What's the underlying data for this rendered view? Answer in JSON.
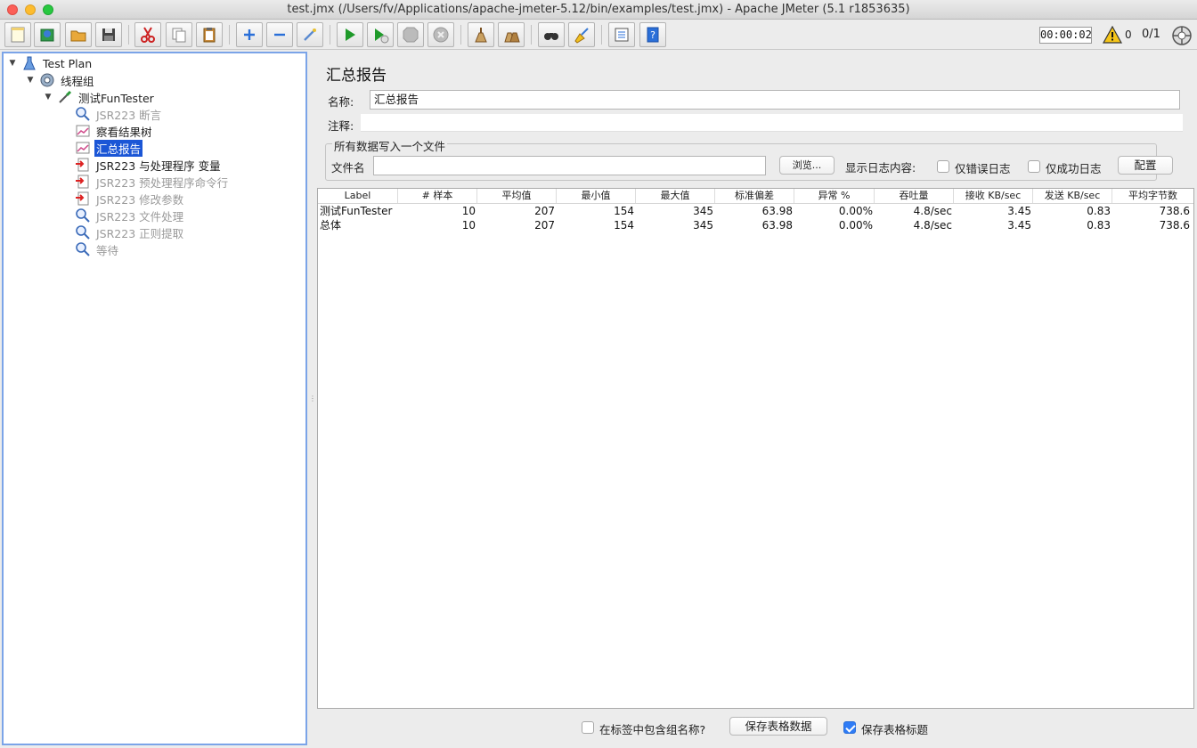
{
  "window": {
    "title": "test.jmx (/Users/fv/Applications/apache-jmeter-5.12/bin/examples/test.jmx) - Apache JMeter (5.1 r1853635)"
  },
  "toolbar": {
    "timer": "00:00:02",
    "warning_count": "0",
    "thread_count": "0/1"
  },
  "tree": {
    "nodes": [
      {
        "label": "Test Plan"
      },
      {
        "label": "线程组"
      },
      {
        "label": "测试FunTester"
      },
      {
        "label": "JSR223 断言"
      },
      {
        "label": "察看结果树"
      },
      {
        "label": "汇总报告"
      },
      {
        "label": "JSR223 与处理程序 变量"
      },
      {
        "label": "JSR223 预处理程序命令行"
      },
      {
        "label": "JSR223 修改参数"
      },
      {
        "label": "JSR223 文件处理"
      },
      {
        "label": "JSR223 正则提取"
      },
      {
        "label": "等待"
      }
    ]
  },
  "panel": {
    "title": "汇总报告",
    "name_label": "名称:",
    "name_value": "汇总报告",
    "comment_label": "注释:",
    "comment_value": "",
    "file_group_title": "所有数据写入一个文件",
    "filename_label": "文件名",
    "filename_value": "",
    "browse_button": "浏览...",
    "log_content_label": "显示日志内容:",
    "errors_only_label": "仅错误日志",
    "success_only_label": "仅成功日志",
    "configure_button": "配置"
  },
  "table": {
    "headers": [
      "Label",
      "# 样本",
      "平均值",
      "最小值",
      "最大值",
      "标准偏差",
      "异常 %",
      "吞吐量",
      "接收 KB/sec",
      "发送 KB/sec",
      "平均字节数"
    ],
    "rows": [
      [
        "测试FunTester",
        "10",
        "207",
        "154",
        "345",
        "63.98",
        "0.00%",
        "4.8/sec",
        "3.45",
        "0.83",
        "738.6"
      ],
      [
        "总体",
        "10",
        "207",
        "154",
        "345",
        "63.98",
        "0.00%",
        "4.8/sec",
        "3.45",
        "0.83",
        "738.6"
      ]
    ]
  },
  "bottom": {
    "include_group_label": "在标签中包含组名称?",
    "save_table_button": "保存表格数据",
    "save_header_label": "保存表格标题",
    "save_header_checked": true
  }
}
